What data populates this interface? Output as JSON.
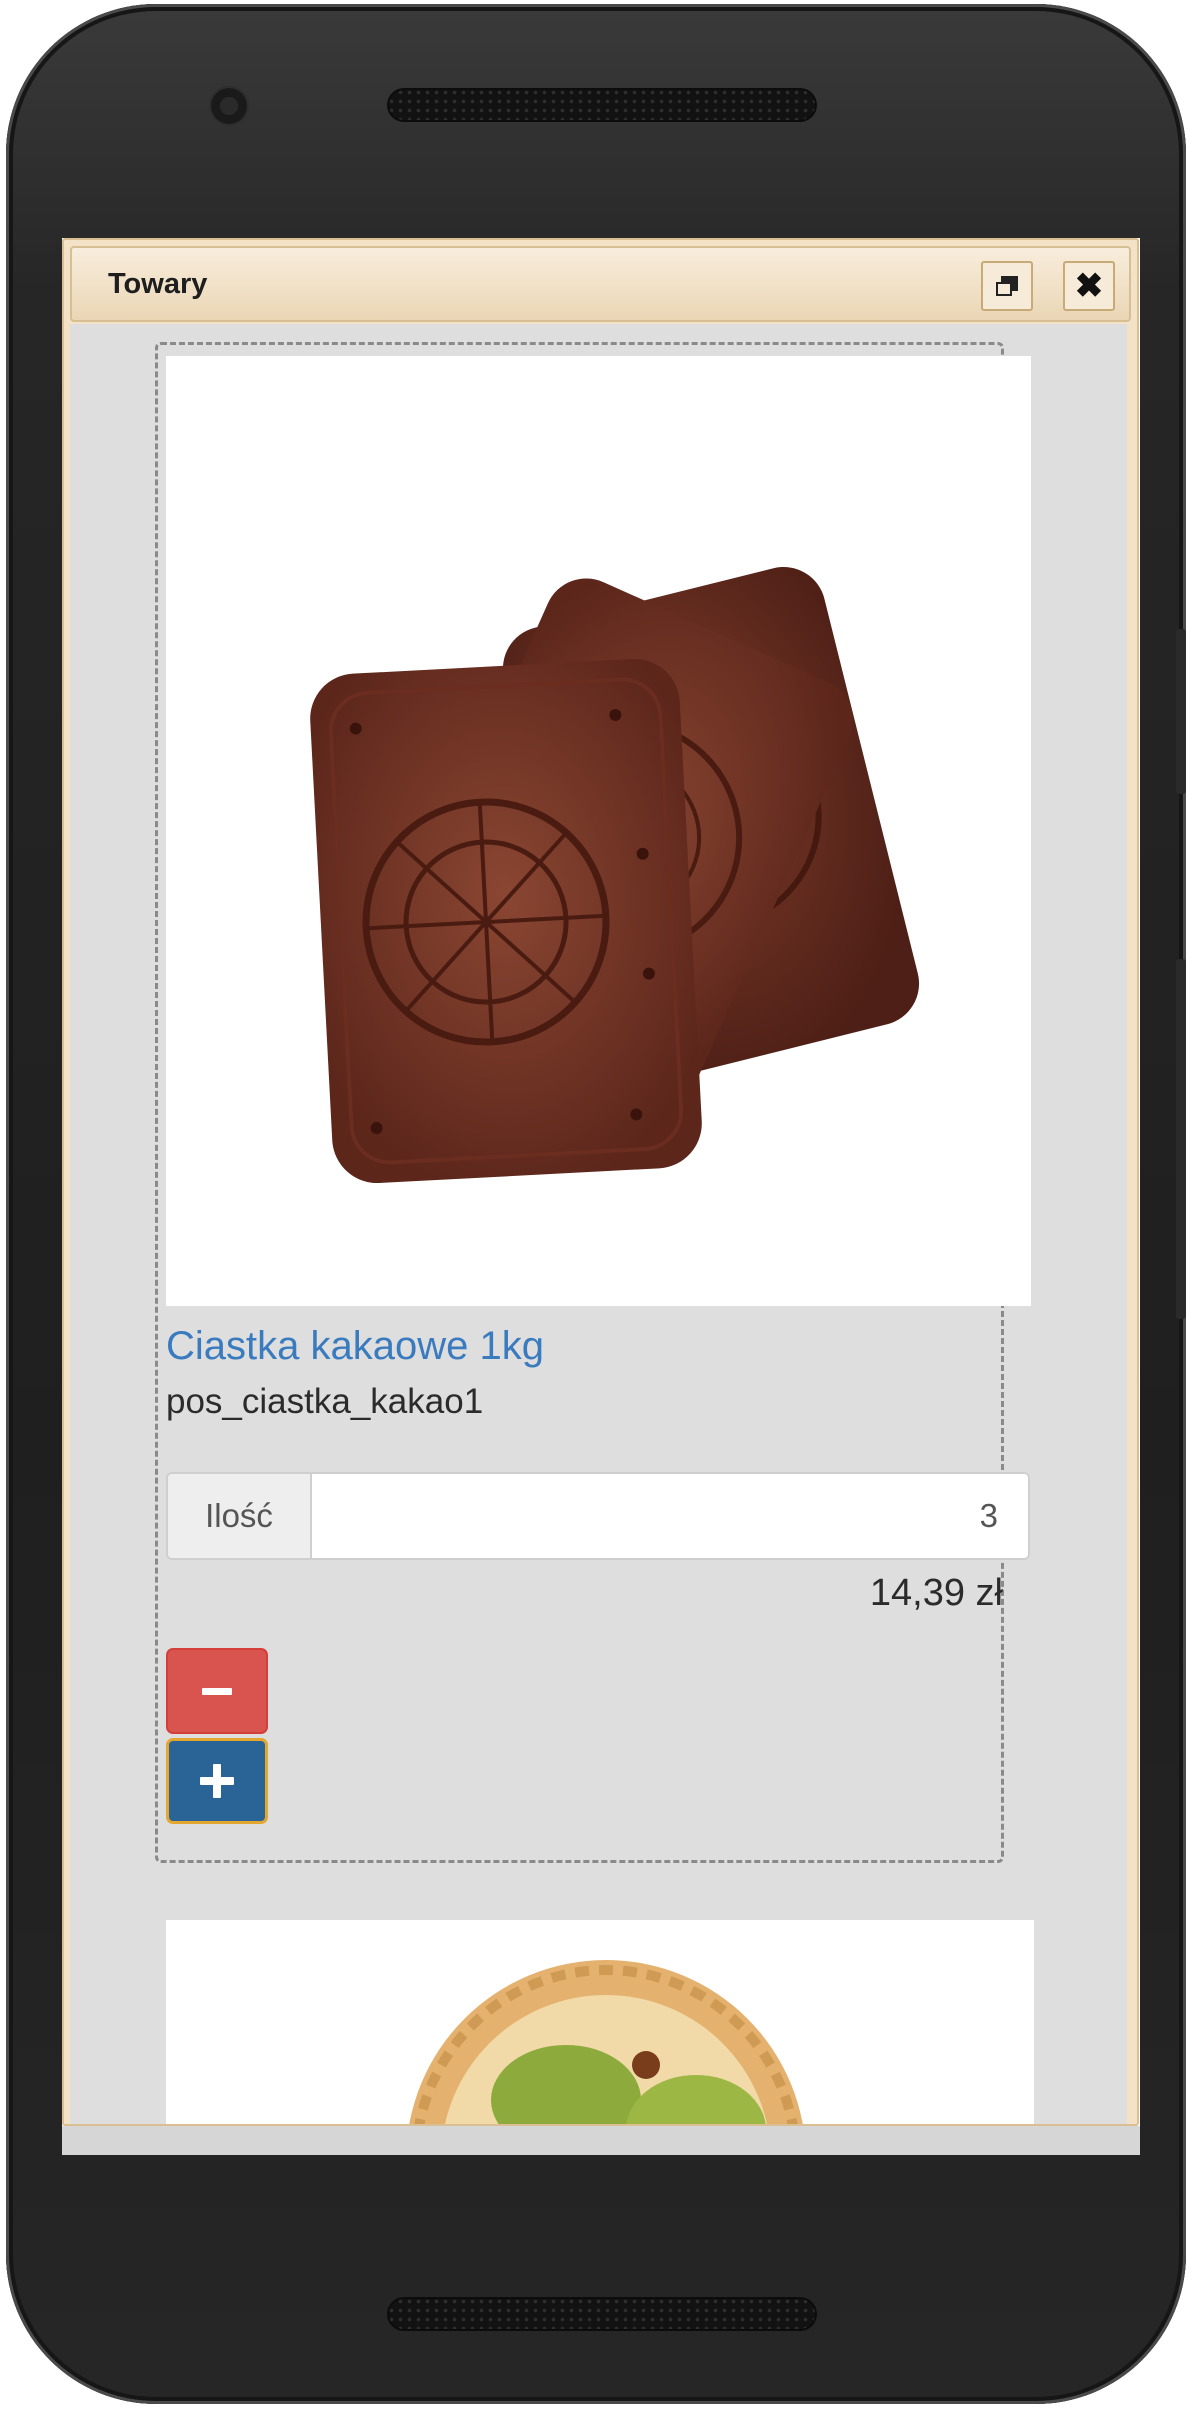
{
  "window": {
    "title": "Towary",
    "buttons": {
      "restore_icon": "restore-window-icon",
      "close_icon": "close-icon",
      "close_glyph": "✖"
    }
  },
  "product": {
    "name": "Ciastka kakaowe 1kg",
    "code": "pos_ciastka_kakao1",
    "quantity_label": "Ilość",
    "quantity_value": "3",
    "price": "14,39 zł",
    "minus_icon": "minus-icon",
    "plus_icon": "plus-icon"
  },
  "colors": {
    "link": "#3a7bbf",
    "minus_button": "#d9534f",
    "plus_button": "#2a6496",
    "plus_button_focus_border": "#e3a72f",
    "window_chrome": "#f3e2c6",
    "content_background": "#dedede"
  }
}
